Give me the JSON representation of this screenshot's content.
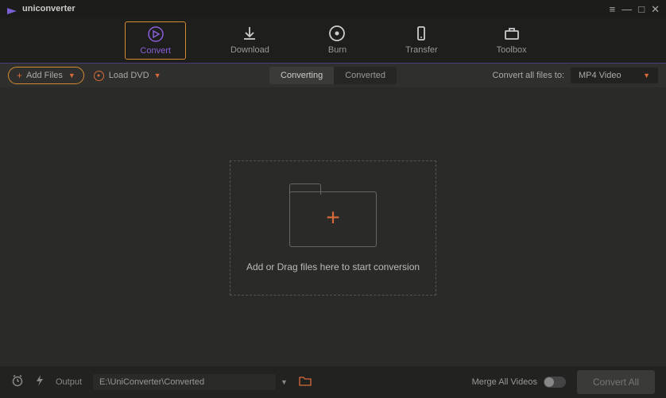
{
  "titlebar": {
    "title": "uniconverter"
  },
  "nav": {
    "tabs": [
      {
        "label": "Convert"
      },
      {
        "label": "Download"
      },
      {
        "label": "Burn"
      },
      {
        "label": "Transfer"
      },
      {
        "label": "Toolbox"
      }
    ]
  },
  "toolbar": {
    "add_files_label": "Add Files",
    "load_dvd_label": "Load DVD",
    "segmented": {
      "converting": "Converting",
      "converted": "Converted"
    },
    "convert_all_label": "Convert all files to:",
    "format_selected": "MP4 Video"
  },
  "dropzone": {
    "text": "Add or Drag files here to start conversion"
  },
  "bottombar": {
    "output_label": "Output",
    "output_path": "E:\\UniConverter\\Converted",
    "merge_label": "Merge All Videos",
    "convert_all_btn": "Convert All"
  }
}
